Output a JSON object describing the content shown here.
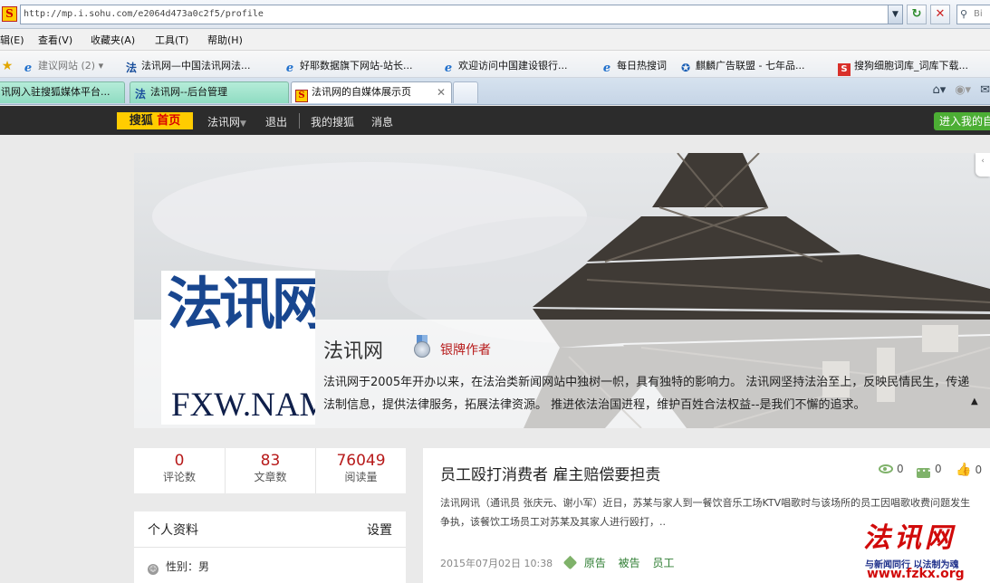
{
  "browser": {
    "address": "http://mp.i.sohu.com/e2064d473a0c2f5/profile",
    "search_placeholder": "Bi",
    "menu": [
      "辑(E)",
      "查看(V)",
      "收藏夹(A)",
      "工具(T)",
      "帮助(H)"
    ],
    "favorites": [
      {
        "label": "建议网站 (2) ▾",
        "icon": "ie-icon"
      },
      {
        "label": "法讯网—中国法讯网法...",
        "icon": "fa-icon"
      },
      {
        "label": "好耶数据旗下网站-站长...",
        "icon": "ie-icon"
      },
      {
        "label": "欢迎访问中国建设银行...",
        "icon": "ie-icon"
      },
      {
        "label": "每日热搜词",
        "icon": "ie-icon"
      },
      {
        "label": "麒麟广告联盟 - 七年品...",
        "icon": "qilin-icon"
      },
      {
        "label": "搜狗细胞词库_词库下载...",
        "icon": "sogou-icon"
      }
    ],
    "tabs": [
      {
        "label": "讯网入驻搜狐媒体平台..."
      },
      {
        "label": "法讯网--后台管理"
      },
      {
        "label": "法讯网的自媒体展示页"
      }
    ]
  },
  "nav": {
    "home_brand": "搜狐",
    "home_label": "首页",
    "links": [
      "法讯网",
      "退出",
      "我的搜狐",
      "消息"
    ],
    "enter_button": "进入我的自"
  },
  "profile": {
    "logo_main": "法讯网",
    "logo_sub": "FXW.NAME",
    "name": "法讯网",
    "badge": "银牌作者",
    "description": "法讯网于2005年开办以来，在法治类新闻网站中独树一帜，具有独特的影响力。 法讯网坚持法治至上，反映民情民生，传递法制信息，提供法律服务，拓展法律资源。 推进依法治国进程，维护百姓合法权益--是我们不懈的追求。"
  },
  "stats": [
    {
      "value": "0",
      "label": "评论数"
    },
    {
      "value": "83",
      "label": "文章数"
    },
    {
      "value": "76049",
      "label": "阅读量"
    }
  ],
  "profile_card": {
    "title": "个人资料",
    "settings": "设置",
    "gender": "性别：男"
  },
  "article": {
    "title": "员工殴打消费者 雇主赔偿要担责",
    "views": "0",
    "comments": "0",
    "likes": "0",
    "summary": "法讯网讯（通讯员 张庆元、谢小军）近日，苏某与家人到一餐饮音乐工场KTV唱歌时与该场所的员工因唱歌收费问题发生争执，该餐饮工场员工对苏某及其家人进行殴打，..",
    "date": "2015年07月02日 10:38",
    "tags": [
      "原告",
      "被告",
      "员工"
    ]
  },
  "watermark": {
    "main": "法讯网",
    "slogan": "与新闻同行 以法制为魂",
    "url": "www.fzkx.org"
  }
}
